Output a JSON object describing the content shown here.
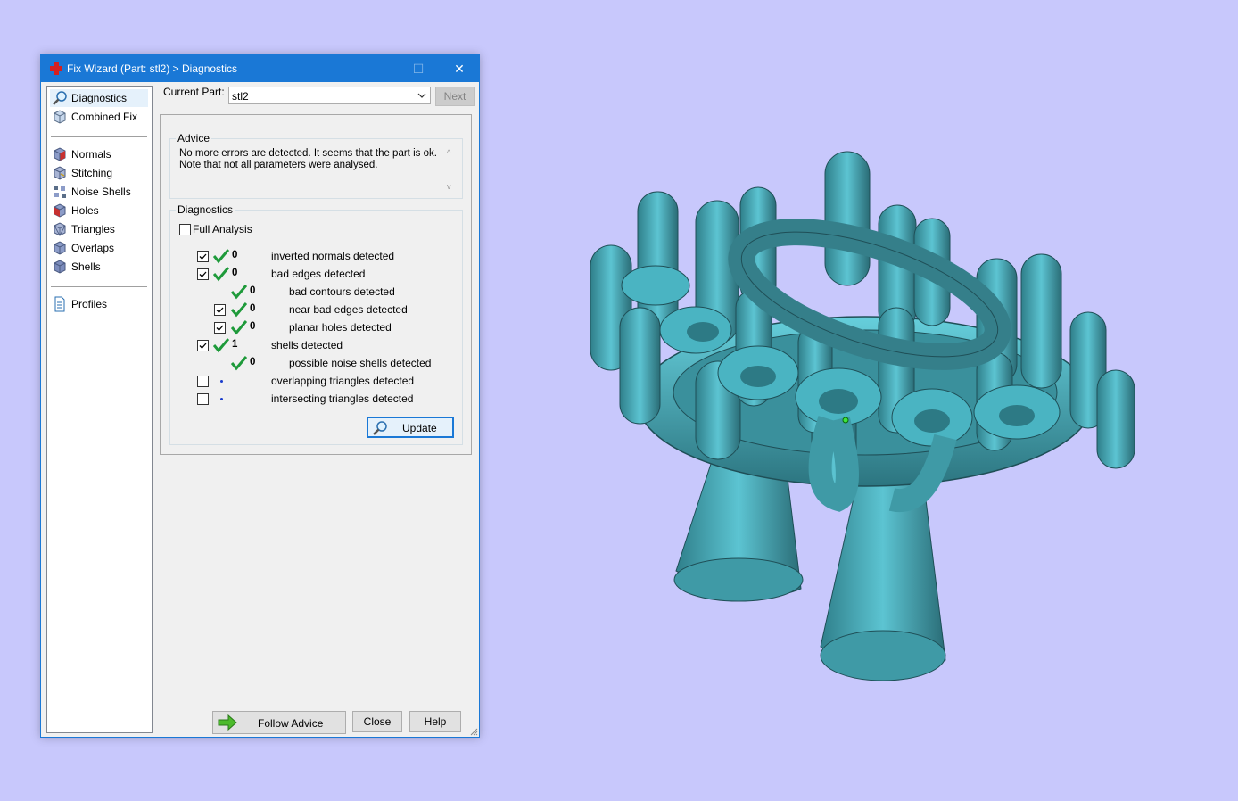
{
  "window": {
    "title": "Fix Wizard (Part: stl2) > Diagnostics",
    "controls": {
      "minimize": "—",
      "maximize": "☐",
      "close": "✕"
    }
  },
  "nav": {
    "top": [
      {
        "label": "Diagnostics",
        "icon": "magnifier-icon"
      },
      {
        "label": "Combined Fix",
        "icon": "cube-icon"
      }
    ],
    "fixes": [
      {
        "label": "Normals",
        "icon": "normals-cube-icon"
      },
      {
        "label": "Stitching",
        "icon": "stitching-cube-icon"
      },
      {
        "label": "Noise Shells",
        "icon": "noise-shells-icon"
      },
      {
        "label": "Holes",
        "icon": "holes-cube-icon"
      },
      {
        "label": "Triangles",
        "icon": "triangles-cube-icon"
      },
      {
        "label": "Overlaps",
        "icon": "overlaps-cube-icon"
      },
      {
        "label": "Shells",
        "icon": "shells-cube-icon"
      }
    ],
    "bottom": [
      {
        "label": "Profiles",
        "icon": "document-icon"
      }
    ]
  },
  "current_part": {
    "label": "Current Part:",
    "value": "stl2"
  },
  "next_button": "Next",
  "advice": {
    "title": "Advice",
    "line1": "No more errors are detected. It seems that the part is ok.",
    "line2": "Note that not all parameters were analysed."
  },
  "diagnostics": {
    "title": "Diagnostics",
    "full_analysis": "Full Analysis",
    "rows": [
      {
        "count": "0",
        "label": "inverted normals detected"
      },
      {
        "count": "0",
        "label": "bad edges detected"
      },
      {
        "count": "0",
        "label": "bad contours detected"
      },
      {
        "count": "0",
        "label": "near bad edges detected"
      },
      {
        "count": "0",
        "label": "planar holes detected"
      },
      {
        "count": "1",
        "label": "shells detected"
      },
      {
        "count": "0",
        "label": "possible noise shells detected"
      },
      {
        "count": "",
        "label": "overlapping triangles detected"
      },
      {
        "count": "",
        "label": "intersecting triangles detected"
      }
    ],
    "update_button": "Update"
  },
  "footer": {
    "follow_advice": "Follow Advice",
    "close": "Close",
    "help": "Help"
  },
  "colors": {
    "desktop": "#c8c8fc",
    "titlebar": "#1a78d6",
    "check": "#1e9a3a",
    "model": "#3f9aa6"
  }
}
